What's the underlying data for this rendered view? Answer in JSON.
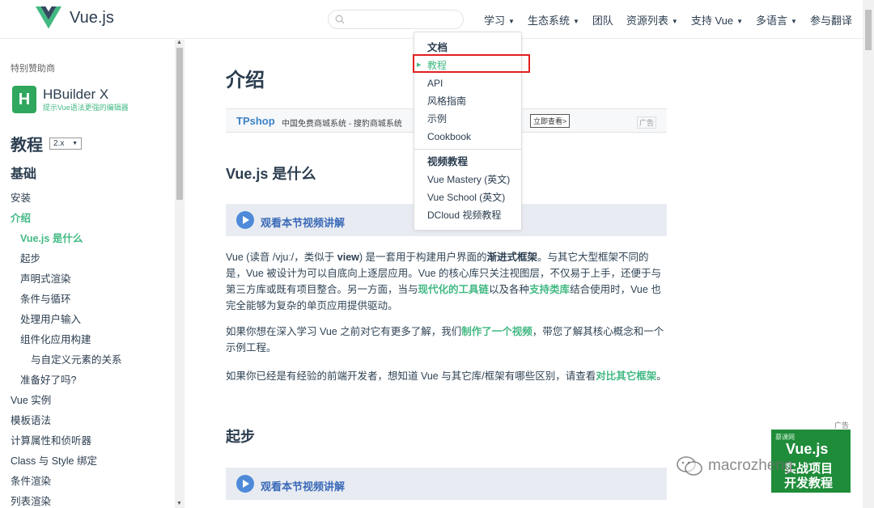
{
  "header": {
    "logo_text": "Vue.js",
    "search_placeholder": "",
    "nav": [
      {
        "label": "学习",
        "caret": "▼"
      },
      {
        "label": "生态系统",
        "caret": "▼"
      },
      {
        "label": "团队",
        "caret": ""
      },
      {
        "label": "资源列表",
        "caret": "▼"
      },
      {
        "label": "支持 Vue",
        "caret": "▼"
      },
      {
        "label": "多语言",
        "caret": "▼"
      },
      {
        "label": "参与翻译",
        "caret": ""
      }
    ]
  },
  "dropdown": {
    "group1": "文档",
    "items1": [
      "教程",
      "API",
      "风格指南",
      "示例",
      "Cookbook"
    ],
    "current_arrow": "▶",
    "group2": "视频教程",
    "items2": [
      "Vue Mastery (英文)",
      "Vue School (英文)",
      "DCloud 视频教程"
    ]
  },
  "sidebar": {
    "sponsor_label": "特别赞助商",
    "sponsor_logo": "H",
    "sponsor_name": "HBuilder X",
    "sponsor_sub": "提示Vue语法更强的编辑器",
    "title": "教程",
    "version": "2.x",
    "version_caret": "▼",
    "section": "基础",
    "items": [
      {
        "label": "安装",
        "level": 0,
        "state": ""
      },
      {
        "label": "介绍",
        "level": 0,
        "state": "active"
      },
      {
        "label": "Vue.js 是什么",
        "level": 1,
        "state": "cur"
      },
      {
        "label": "起步",
        "level": 1,
        "state": ""
      },
      {
        "label": "声明式渲染",
        "level": 1,
        "state": ""
      },
      {
        "label": "条件与循环",
        "level": 1,
        "state": ""
      },
      {
        "label": "处理用户输入",
        "level": 1,
        "state": ""
      },
      {
        "label": "组件化应用构建",
        "level": 1,
        "state": ""
      },
      {
        "label": "与自定义元素的关系",
        "level": 2,
        "state": ""
      },
      {
        "label": "准备好了吗?",
        "level": 1,
        "state": ""
      },
      {
        "label": "Vue 实例",
        "level": 0,
        "state": ""
      },
      {
        "label": "模板语法",
        "level": 0,
        "state": ""
      },
      {
        "label": "计算属性和侦听器",
        "level": 0,
        "state": ""
      },
      {
        "label": "Class 与 Style 绑定",
        "level": 0,
        "state": ""
      },
      {
        "label": "条件渲染",
        "level": 0,
        "state": ""
      },
      {
        "label": "列表渲染",
        "level": 0,
        "state": ""
      }
    ]
  },
  "main": {
    "title": "介绍",
    "ad": {
      "brand": "TPshop",
      "text": "中国免费商城系统 - 搜豹商城系统",
      "button": "立即查看>",
      "tag": "广告"
    },
    "h2_what": "Vue.js 是什么",
    "video_label": "观看本节视频讲解",
    "p1": {
      "a": "Vue (读音 /vjuː/，类似于 ",
      "b": "view",
      "c": ") 是一套用于构建用户界面的",
      "d": "渐进式框架",
      "e": "。与其它大型框架不同的是，Vue 被设计为可以自底向上逐层应用。Vue 的核心库只关注视图层，不仅易于上手，还便于与第三方库或既有项目整合。另一方面，当与",
      "f": "现代化的工具链",
      "g": "以及各种",
      "h": "支持类库",
      "i": "结合使用时，Vue 也完全能够为复杂的单页应用提供驱动。"
    },
    "p2": {
      "a": "如果你想在深入学习 Vue 之前对它有更多了解，我们",
      "b": "制作了一个视频",
      "c": "，带您了解其核心概念和一个示例工程。"
    },
    "p3": {
      "a": "如果你已经是有经验的前端开发者，想知道 Vue 与其它库/框架有哪些区别，请查看",
      "b": "对比其它框架",
      "c": "。"
    },
    "h2_start": "起步",
    "video_label2": "观看本节视频讲解"
  },
  "bottom_ad": {
    "tag": "广告",
    "brand": "慕课网",
    "line1": "Vue.js",
    "line2": "实战项目",
    "line3": "开发教程"
  },
  "watermark": "macrozheng",
  "colors": {
    "accent": "#42b983",
    "text": "#2c3e50",
    "highlight": "#e02020"
  }
}
